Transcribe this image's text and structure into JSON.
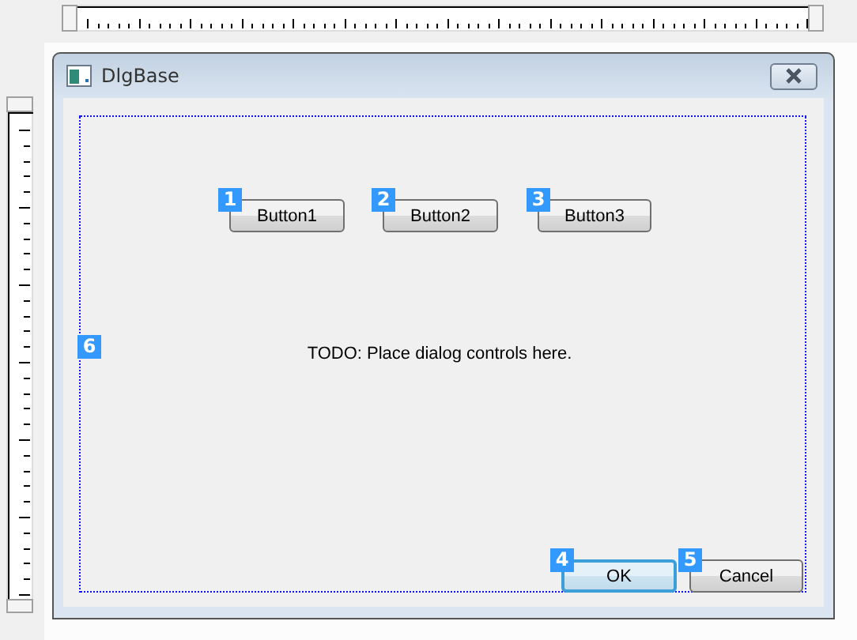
{
  "window": {
    "title": "DlgBase"
  },
  "controls": [
    {
      "kind": "button",
      "label": "Button1",
      "tab_order": "1",
      "default": false
    },
    {
      "kind": "button",
      "label": "Button2",
      "tab_order": "2",
      "default": false
    },
    {
      "kind": "button",
      "label": "Button3",
      "tab_order": "3",
      "default": false
    },
    {
      "kind": "label",
      "label": "TODO: Place dialog controls here.",
      "tab_order": "6"
    },
    {
      "kind": "button",
      "label": "OK",
      "tab_order": "4",
      "default": true
    },
    {
      "kind": "button",
      "label": "Cancel",
      "tab_order": "5",
      "default": false
    }
  ]
}
